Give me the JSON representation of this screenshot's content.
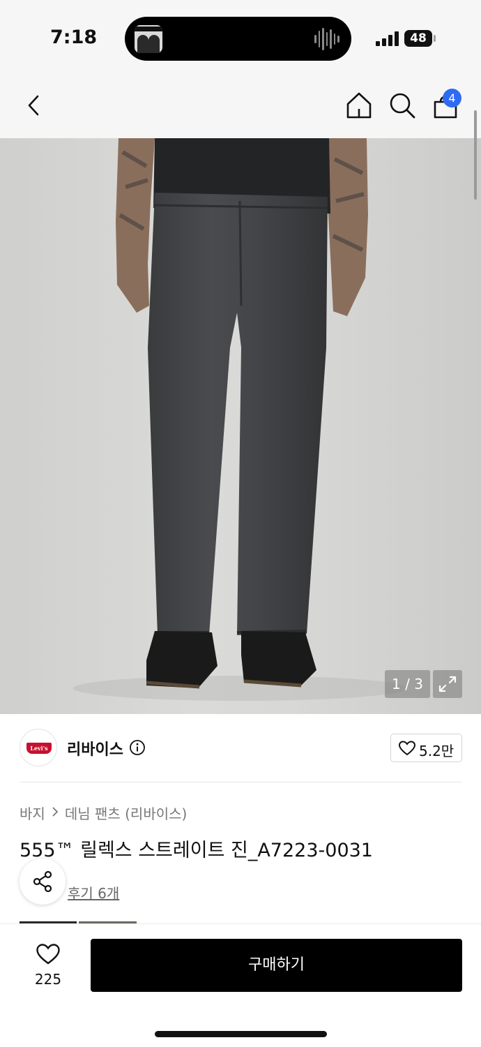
{
  "status_bar": {
    "time": "7:18",
    "battery": "48",
    "icons": [
      "now-playing-artwork",
      "audio-waveform-icon",
      "cellular-signal-icon",
      "battery-icon"
    ]
  },
  "header": {
    "back_icon": "chevron-left-icon",
    "home_icon": "home-icon",
    "search_icon": "search-icon",
    "cart_icon": "shopping-bag-icon",
    "cart_badge": "4",
    "badge_color": "#2f6bf2"
  },
  "gallery": {
    "counter": "1 / 3",
    "current_index": 1,
    "total": 3,
    "expand_icon": "expand-icon"
  },
  "brand": {
    "logo_text": "Levi's",
    "logo_color": "#c8102e",
    "name": "리바이스",
    "info_icon": "info-icon",
    "like_icon": "heart-outline-icon",
    "like_count": "5.2만"
  },
  "breadcrumb": {
    "category": "바지",
    "separator_icon": "chevron-right-icon",
    "subcategory": "데님 팬츠 (리바이스)"
  },
  "product": {
    "title": "555™ 릴렉스 스트레이트 진_A7223-0031",
    "reviews": "후기 6개",
    "share_icon": "share-icon"
  },
  "bottom_bar": {
    "wish_icon": "heart-outline-icon",
    "wish_count": "225",
    "buy_label": "구매하기",
    "buy_color": "#000000"
  }
}
